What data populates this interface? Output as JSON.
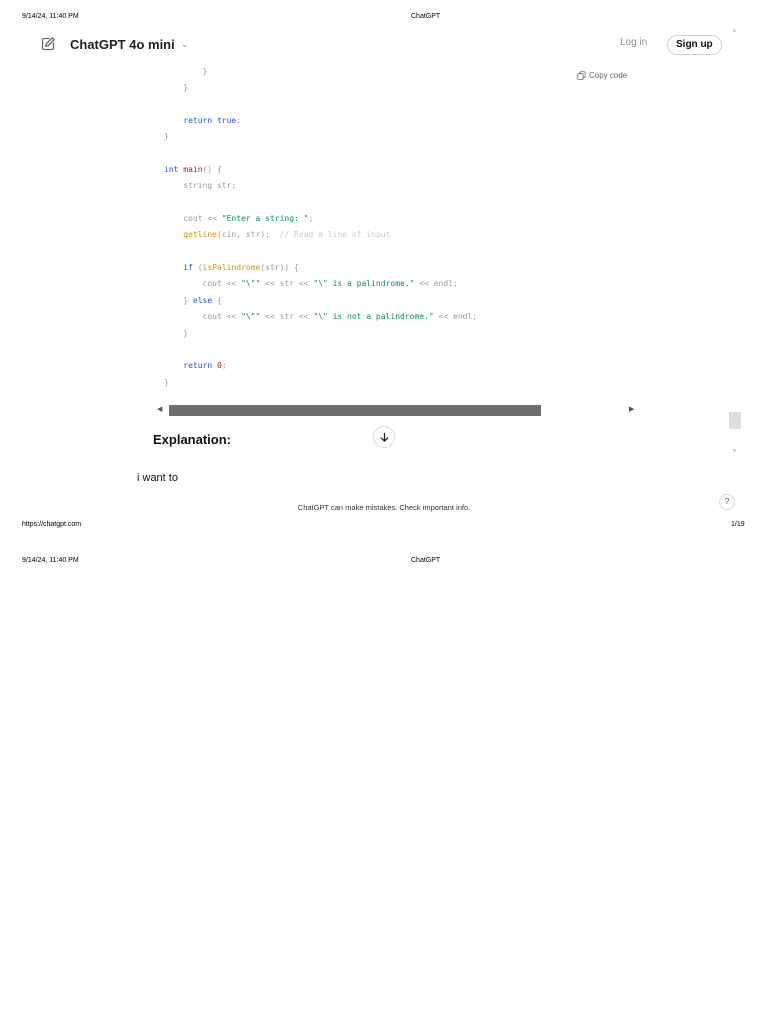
{
  "print_header": {
    "date": "9/14/24, 11:40 PM",
    "title": "ChatGPT"
  },
  "app_header": {
    "model_label": "ChatGPT 4o mini",
    "login_label": "Log in",
    "signup_label": "Sign up"
  },
  "code_block": {
    "copy_label": "Copy code",
    "lines": [
      [
        {
          "t": "        }",
          "c": ""
        }
      ],
      [
        {
          "t": "    }",
          "c": ""
        }
      ],
      [
        {
          "t": "",
          "c": ""
        }
      ],
      [
        {
          "t": "    ",
          "c": ""
        },
        {
          "t": "return true",
          "c": "kw"
        },
        {
          "t": ";",
          "c": ""
        }
      ],
      [
        {
          "t": "}",
          "c": ""
        }
      ],
      [
        {
          "t": "",
          "c": ""
        }
      ],
      [
        {
          "t": "int ",
          "c": "kw"
        },
        {
          "t": "main",
          "c": "kw2"
        },
        {
          "t": "() {",
          "c": ""
        }
      ],
      [
        {
          "t": "    string str;",
          "c": ""
        }
      ],
      [
        {
          "t": "",
          "c": ""
        }
      ],
      [
        {
          "t": "    cout << ",
          "c": ""
        },
        {
          "t": "\"Enter a string: \"",
          "c": "str"
        },
        {
          "t": ";",
          "c": ""
        }
      ],
      [
        {
          "t": "    ",
          "c": ""
        },
        {
          "t": "getline",
          "c": "fn"
        },
        {
          "t": "(cin, str);  ",
          "c": ""
        },
        {
          "t": "// Read a line of input",
          "c": "cmt"
        }
      ],
      [
        {
          "t": "",
          "c": ""
        }
      ],
      [
        {
          "t": "    ",
          "c": ""
        },
        {
          "t": "if",
          "c": "kw"
        },
        {
          "t": " (",
          "c": ""
        },
        {
          "t": "isPalindrome",
          "c": "fn"
        },
        {
          "t": "(str)) {",
          "c": ""
        }
      ],
      [
        {
          "t": "        cout << ",
          "c": ""
        },
        {
          "t": "\"\\\"\"",
          "c": "str"
        },
        {
          "t": " << str << ",
          "c": ""
        },
        {
          "t": "\"\\\" is a palindrome.\"",
          "c": "str"
        },
        {
          "t": " << endl;",
          "c": ""
        }
      ],
      [
        {
          "t": "    } ",
          "c": ""
        },
        {
          "t": "else",
          "c": "kw"
        },
        {
          "t": " {",
          "c": ""
        }
      ],
      [
        {
          "t": "        cout << ",
          "c": ""
        },
        {
          "t": "\"\\\"\"",
          "c": "str"
        },
        {
          "t": " << str << ",
          "c": ""
        },
        {
          "t": "\"\\\" is not a palindrome.\"",
          "c": "str"
        },
        {
          "t": " << endl;",
          "c": ""
        }
      ],
      [
        {
          "t": "    }",
          "c": ""
        }
      ],
      [
        {
          "t": "",
          "c": ""
        }
      ],
      [
        {
          "t": "    ",
          "c": ""
        },
        {
          "t": "return",
          "c": "kw"
        },
        {
          "t": " ",
          "c": ""
        },
        {
          "t": "0",
          "c": "kw2"
        },
        {
          "t": ";",
          "c": ""
        }
      ],
      [
        {
          "t": "}",
          "c": ""
        }
      ]
    ]
  },
  "message": {
    "explanation_heading": "Explanation:",
    "user_prompt": "i want to"
  },
  "footer": {
    "disclaimer": "ChatGPT can make mistakes. Check important info.",
    "help_label": "?"
  },
  "print_footer": {
    "url": "https://chatgpt.com",
    "page": "1/19"
  },
  "page2_header": {
    "date": "9/14/24, 11:40 PM",
    "title": "ChatGPT"
  },
  "icons": {
    "edit": "edit-icon",
    "chevron": "chevron-down-icon",
    "copy": "copy-icon",
    "scroll_down": "arrow-down-icon"
  }
}
